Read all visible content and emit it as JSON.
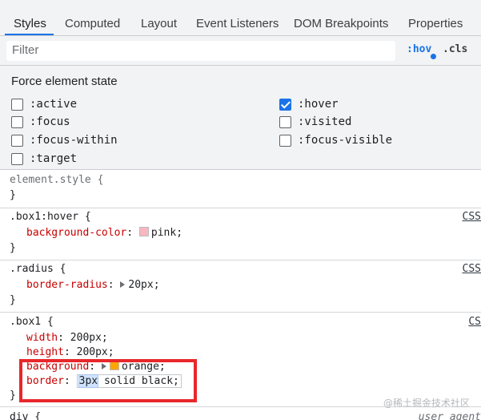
{
  "tabs": [
    {
      "label": "Styles"
    },
    {
      "label": "Computed"
    },
    {
      "label": "Layout"
    },
    {
      "label": "Event Listeners"
    },
    {
      "label": "DOM Breakpoints"
    },
    {
      "label": "Properties"
    }
  ],
  "active_tab": "Styles",
  "filter": {
    "placeholder": "Filter",
    "value": ""
  },
  "toolbar": {
    "hov": ":hov",
    "cls": ".cls"
  },
  "force_state": {
    "title": "Force element state",
    "states": [
      {
        "label": ":active",
        "checked": false
      },
      {
        "label": ":hover",
        "checked": true
      },
      {
        "label": ":focus",
        "checked": false
      },
      {
        "label": ":visited",
        "checked": false
      },
      {
        "label": ":focus-within",
        "checked": false
      },
      {
        "label": ":focus-visible",
        "checked": false
      },
      {
        "label": ":target",
        "checked": false
      }
    ]
  },
  "rules": {
    "element_style": {
      "selector": "element.style {",
      "close": "}"
    },
    "hover": {
      "selector": ".box1:hover {",
      "source": "CSS",
      "prop": "background-color",
      "value": "pink;",
      "swatch": "#f7b6c2",
      "close": "}"
    },
    "radius": {
      "selector": ".radius {",
      "source": "CSS",
      "prop": "border-radius",
      "value": "20px;",
      "close": "}"
    },
    "box1": {
      "selector": ".box1 {",
      "source": "CS",
      "width_prop": "width",
      "width_val": "200px;",
      "height_prop": "height",
      "height_val": "200px;",
      "bg_prop": "background",
      "bg_val": "orange;",
      "bg_swatch": "#ffa500",
      "border_prop": "border",
      "border_val_hl": "3px",
      "border_val_rest": "solid black;",
      "close": "}"
    },
    "div": {
      "selector": "div {",
      "source": "user agent"
    }
  },
  "watermark": "@稀土掘金技术社区",
  "colors": {
    "accent": "#1a73e8",
    "highlight_box": "#e8272b",
    "property": "#c80000"
  }
}
